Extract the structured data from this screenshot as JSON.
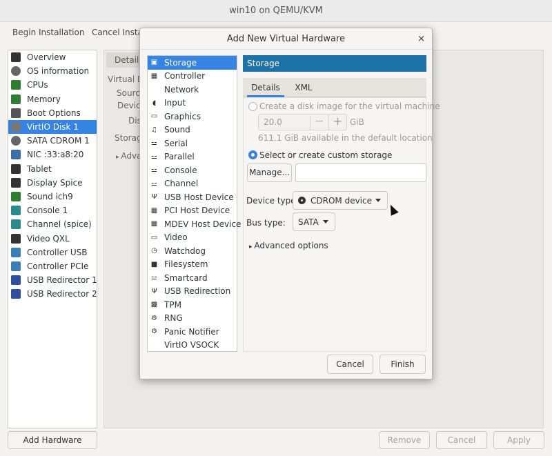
{
  "window": {
    "title": "win10 on QEMU/KVM"
  },
  "toolbar": {
    "begin_installation": "Begin Installation",
    "cancel_installation": "Cancel Installa"
  },
  "hardware_list": [
    {
      "label": "Overview",
      "icon": "monitor-icon"
    },
    {
      "label": "OS information",
      "icon": "info-icon"
    },
    {
      "label": "CPUs",
      "icon": "cpu-icon"
    },
    {
      "label": "Memory",
      "icon": "memory-icon"
    },
    {
      "label": "Boot Options",
      "icon": "gear-icon"
    },
    {
      "label": "VirtIO Disk 1",
      "icon": "disk-icon",
      "selected": true
    },
    {
      "label": "SATA CDROM 1",
      "icon": "cdrom-icon"
    },
    {
      "label": "NIC :33:a8:20",
      "icon": "network-icon"
    },
    {
      "label": "Tablet",
      "icon": "tablet-icon"
    },
    {
      "label": "Display Spice",
      "icon": "display-icon"
    },
    {
      "label": "Sound ich9",
      "icon": "sound-icon"
    },
    {
      "label": "Console 1",
      "icon": "console-icon"
    },
    {
      "label": "Channel (spice)",
      "icon": "channel-icon"
    },
    {
      "label": "Video QXL",
      "icon": "video-icon"
    },
    {
      "label": "Controller USB",
      "icon": "controller-icon"
    },
    {
      "label": "Controller PCIe",
      "icon": "controller-icon"
    },
    {
      "label": "USB Redirector 1",
      "icon": "usb-icon"
    },
    {
      "label": "USB Redirector 2",
      "icon": "usb-icon"
    }
  ],
  "main": {
    "tab_details": "Details",
    "labels": [
      "Virtual D",
      "Source",
      "Device",
      "Disk",
      "Storage",
      "Adva"
    ]
  },
  "bottom": {
    "add_hardware": "Add Hardware",
    "remove": "Remove",
    "cancel": "Cancel",
    "apply": "Apply"
  },
  "dialog": {
    "title": "Add New Virtual Hardware",
    "close": "×",
    "device_types": [
      {
        "label": "Storage",
        "icon": "storage-icon",
        "glyph": "▣",
        "selected": true
      },
      {
        "label": "Controller",
        "icon": "controller-icon",
        "glyph": "▦"
      },
      {
        "label": "Network",
        "icon": "network-icon",
        "glyph": ""
      },
      {
        "label": "Input",
        "icon": "input-icon",
        "glyph": "◖"
      },
      {
        "label": "Graphics",
        "icon": "graphics-icon",
        "glyph": "▭"
      },
      {
        "label": "Sound",
        "icon": "sound-icon",
        "glyph": "♫"
      },
      {
        "label": "Serial",
        "icon": "serial-icon",
        "glyph": "⚍"
      },
      {
        "label": "Parallel",
        "icon": "parallel-icon",
        "glyph": "⚍"
      },
      {
        "label": "Console",
        "icon": "console-icon",
        "glyph": "⚍"
      },
      {
        "label": "Channel",
        "icon": "channel-icon",
        "glyph": "⚍"
      },
      {
        "label": "USB Host Device",
        "icon": "usb-icon",
        "glyph": "Ψ"
      },
      {
        "label": "PCI Host Device",
        "icon": "pci-icon",
        "glyph": "▦"
      },
      {
        "label": "MDEV Host Device",
        "icon": "mdev-icon",
        "glyph": "▦"
      },
      {
        "label": "Video",
        "icon": "video-icon",
        "glyph": "▭"
      },
      {
        "label": "Watchdog",
        "icon": "watchdog-icon",
        "glyph": "◷"
      },
      {
        "label": "Filesystem",
        "icon": "folder-icon",
        "glyph": "■"
      },
      {
        "label": "Smartcard",
        "icon": "smartcard-icon",
        "glyph": "⚍"
      },
      {
        "label": "USB Redirection",
        "icon": "usb-icon",
        "glyph": "Ψ"
      },
      {
        "label": "TPM",
        "icon": "tpm-icon",
        "glyph": "▩"
      },
      {
        "label": "RNG",
        "icon": "rng-icon",
        "glyph": "⚙"
      },
      {
        "label": "Panic Notifier",
        "icon": "panic-icon",
        "glyph": "⚙"
      },
      {
        "label": "VirtIO VSOCK",
        "icon": "vsock-icon",
        "glyph": ""
      }
    ],
    "pane_title": "Storage",
    "tabs": {
      "details": "Details",
      "xml": "XML"
    },
    "create_disk_label": "Create a disk image for the virtual machine",
    "disk_size": "20.0",
    "disk_unit": "GiB",
    "minus": "—",
    "plus": "+",
    "available_text": "611.1 GiB available in the default location",
    "custom_storage_label": "Select or create custom storage",
    "manage_button": "Manage...",
    "storage_path": "",
    "device_type_label": "Device type:",
    "device_type_value": "CDROM device",
    "bus_type_label": "Bus type:",
    "bus_type_value": "SATA",
    "advanced_options": "Advanced options",
    "cancel_button": "Cancel",
    "finish_button": "Finish"
  }
}
